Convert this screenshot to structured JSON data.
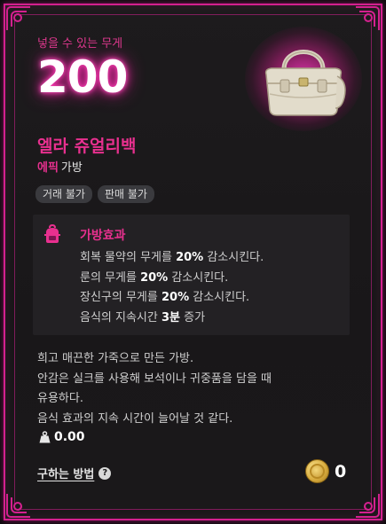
{
  "capacity": {
    "label": "넣을 수 있는 무게",
    "value": "200"
  },
  "item": {
    "name": "엘라 쥬얼리백",
    "grade": "에픽",
    "type": "가방",
    "icon": "handbag-icon"
  },
  "tags": [
    "거래 불가",
    "판매 불가"
  ],
  "effect": {
    "title": "가방효과",
    "icon": "backpack-icon",
    "lines": [
      {
        "pre": "회복 물약의 무게를 ",
        "bold": "20%",
        "post": " 감소시킨다."
      },
      {
        "pre": "룬의 무게를 ",
        "bold": "20%",
        "post": " 감소시킨다."
      },
      {
        "pre": "장신구의 무게를 ",
        "bold": "20%",
        "post": " 감소시킨다."
      },
      {
        "pre": "음식의 지속시간 ",
        "bold": "3분",
        "post": " 증가"
      }
    ]
  },
  "description": [
    "희고 매끈한 가죽으로 만든 가방.",
    "안감은 실크를 사용해 보석이나 귀중품을 담을 때",
    "유용하다.",
    "음식 효과의 지속 시간이 늘어날 것 같다."
  ],
  "weight": {
    "icon": "weight-icon",
    "value": "0.00"
  },
  "howto": {
    "label": "구하는 방법",
    "icon": "question-icon"
  },
  "price": {
    "icon": "gold-coin-icon",
    "value": "0"
  },
  "colors": {
    "accent": "#e8308f",
    "border": "#d4208f",
    "background": "#1b191b"
  }
}
